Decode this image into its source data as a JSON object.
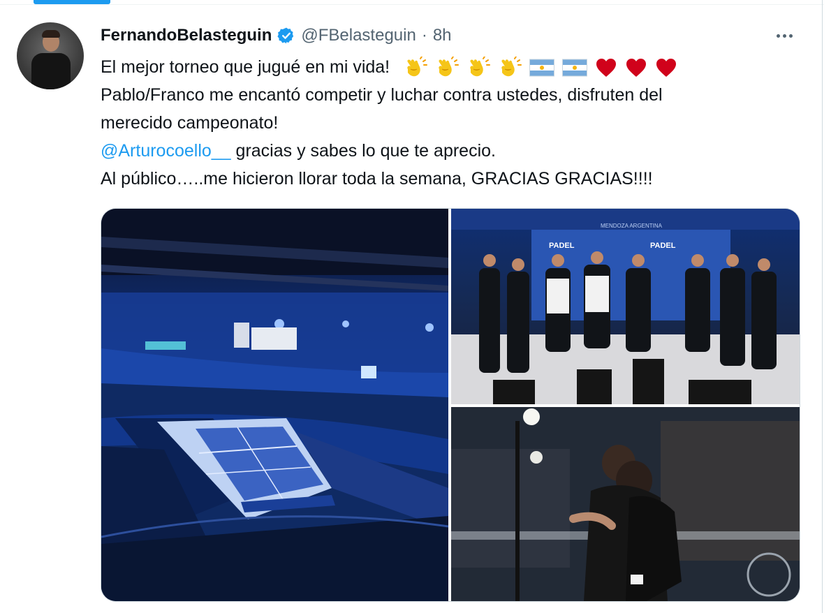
{
  "tweet": {
    "author_name": "FernandoBelasteguin",
    "handle": "@FBelasteguin",
    "separator": "·",
    "time": "8h",
    "text": {
      "line1": "El mejor torneo que jugué en mi vida!",
      "line1_emojis": [
        "clapping-hands",
        "clapping-hands",
        "clapping-hands",
        "clapping-hands",
        "argentina-flag",
        "argentina-flag",
        "red-heart",
        "red-heart",
        "red-heart"
      ],
      "line2": "Pablo/Franco me encantó competir y luchar contra ustedes, disfruten del",
      "line3": "merecido campeonato!",
      "mention": "@Arturocoello__",
      "line4_rest": " gracias y sabes lo que te aprecio.",
      "line5": "Al público…..me hicieron llorar toda la semana, GRACIAS GRACIAS!!!!"
    },
    "photos": {
      "trophy_banner_1": "PADEL",
      "trophy_banner_2": "PADEL",
      "venue_banner": "MENDOZA ARGENTINA"
    }
  },
  "colors": {
    "accent": "#1d9bf0",
    "secondary_text": "#536471",
    "heart": "#d0021b"
  }
}
